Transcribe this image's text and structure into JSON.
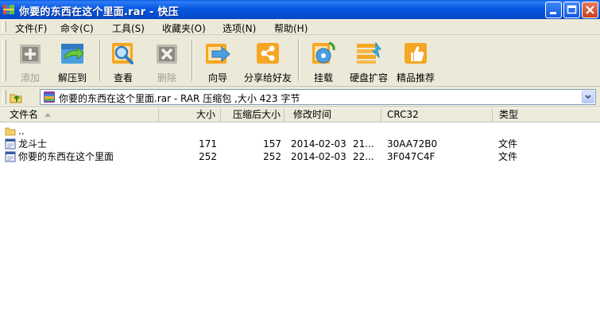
{
  "window": {
    "title": "你要的东西在这个里面.rar - 快压",
    "icon": "rar-app-icon"
  },
  "menu": [
    {
      "label": "文件(F)"
    },
    {
      "label": "命令(C)"
    },
    {
      "label": "工具(S)"
    },
    {
      "label": "收藏夹(O)"
    },
    {
      "label": "选项(N)"
    },
    {
      "label": "帮助(H)"
    }
  ],
  "toolbar": [
    {
      "label": "添加",
      "icon": "add-icon",
      "enabled": false
    },
    {
      "label": "解压到",
      "icon": "extract-icon",
      "enabled": true
    },
    {
      "label": "查看",
      "icon": "view-icon",
      "enabled": true
    },
    {
      "label": "删除",
      "icon": "delete-icon",
      "enabled": false
    },
    {
      "label": "向导",
      "icon": "wizard-icon",
      "enabled": true
    },
    {
      "label": "分享给好友",
      "icon": "share-icon",
      "enabled": true
    },
    {
      "label": "挂载",
      "icon": "mount-icon",
      "enabled": true
    },
    {
      "label": "硬盘扩容",
      "icon": "disk-expand-icon",
      "enabled": true
    },
    {
      "label": "精品推荐",
      "icon": "recommend-icon",
      "enabled": true
    }
  ],
  "address": {
    "text": "你要的东西在这个里面.rar - RAR 压缩包 ,大小 423 字节"
  },
  "columns": [
    "文件名",
    "大小",
    "压缩后大小",
    "修改时间",
    "CRC32",
    "类型"
  ],
  "rows": [
    {
      "name": "..",
      "size": "",
      "packed": "",
      "date": "",
      "time": "",
      "crc": "",
      "type": "",
      "icon": "folder-icon"
    },
    {
      "name": "龙斗士",
      "size": "171",
      "packed": "157",
      "date": "2014-02-03",
      "time": "21...",
      "crc": "30AA72B0",
      "type": "文件",
      "icon": "file-icon"
    },
    {
      "name": "你要的东西在这个里面",
      "size": "252",
      "packed": "252",
      "date": "2014-02-03",
      "time": "22...",
      "crc": "3F047C4F",
      "type": "文件",
      "icon": "file-icon"
    }
  ],
  "colors": {
    "titlebar": "#0657e0",
    "chrome": "#ece9d8",
    "accent_orange": "#f5a623"
  }
}
